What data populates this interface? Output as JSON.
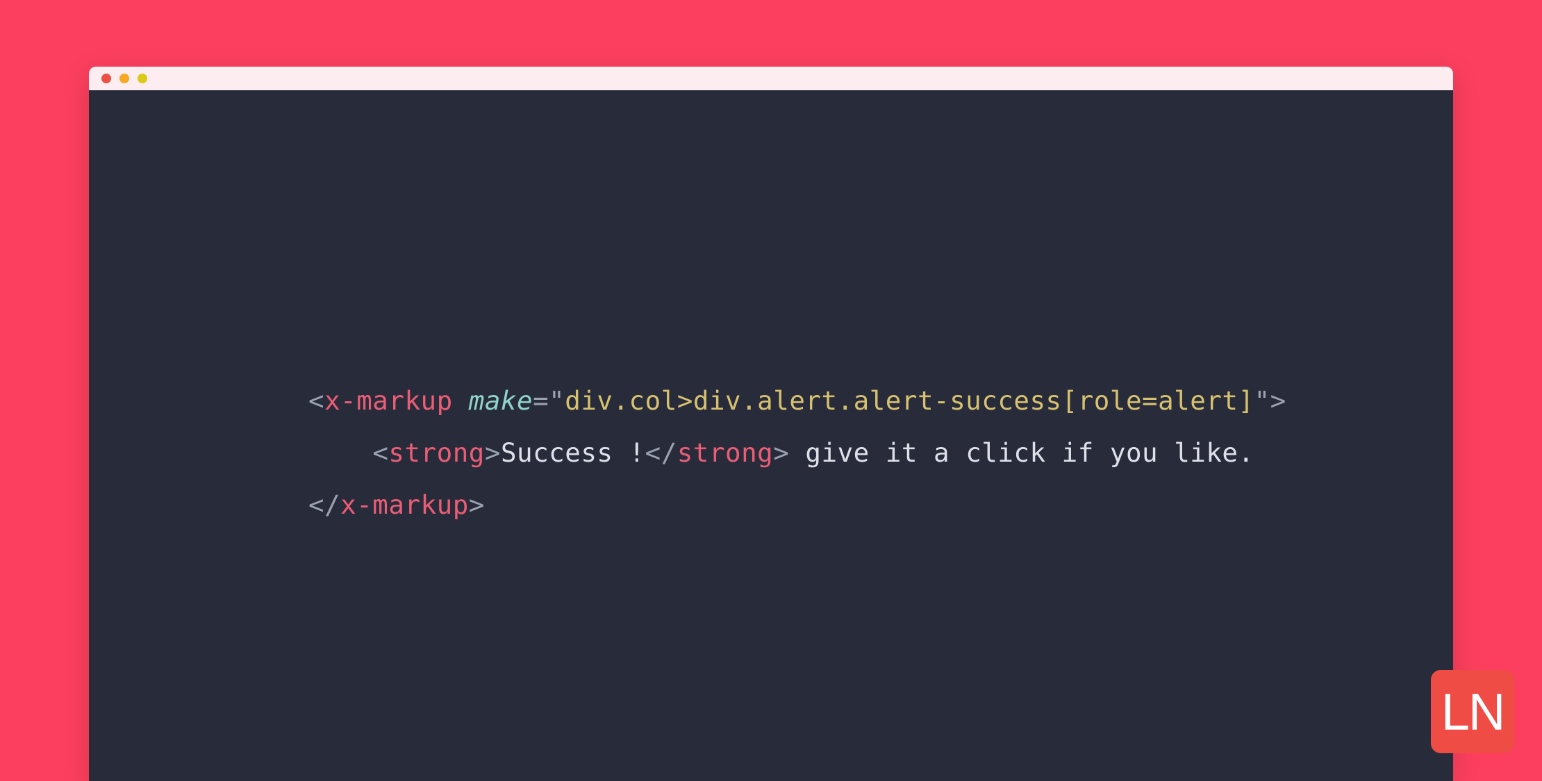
{
  "window": {
    "traffic_lights": {
      "close": "#ec5044",
      "minimize": "#f7a822",
      "zoom": "#dbc91a"
    }
  },
  "code": {
    "line1": {
      "open_bracket": "<",
      "tag": "x-markup",
      "space": " ",
      "attr": "make",
      "equals": "=",
      "quote_open": "\"",
      "string": "div.col>div.alert.alert-success[role=alert]",
      "quote_close": "\"",
      "close_bracket": ">"
    },
    "line2": {
      "indent": "    ",
      "open_bracket": "<",
      "tag": "strong",
      "close_bracket": ">",
      "text1": "Success !",
      "open_bracket2": "</",
      "tag2": "strong",
      "close_bracket2": ">",
      "text2": " give it a click if you like."
    },
    "line3": {
      "open_bracket": "</",
      "tag": "x-markup",
      "close_bracket": ">"
    }
  },
  "logo": {
    "text": "LN"
  }
}
